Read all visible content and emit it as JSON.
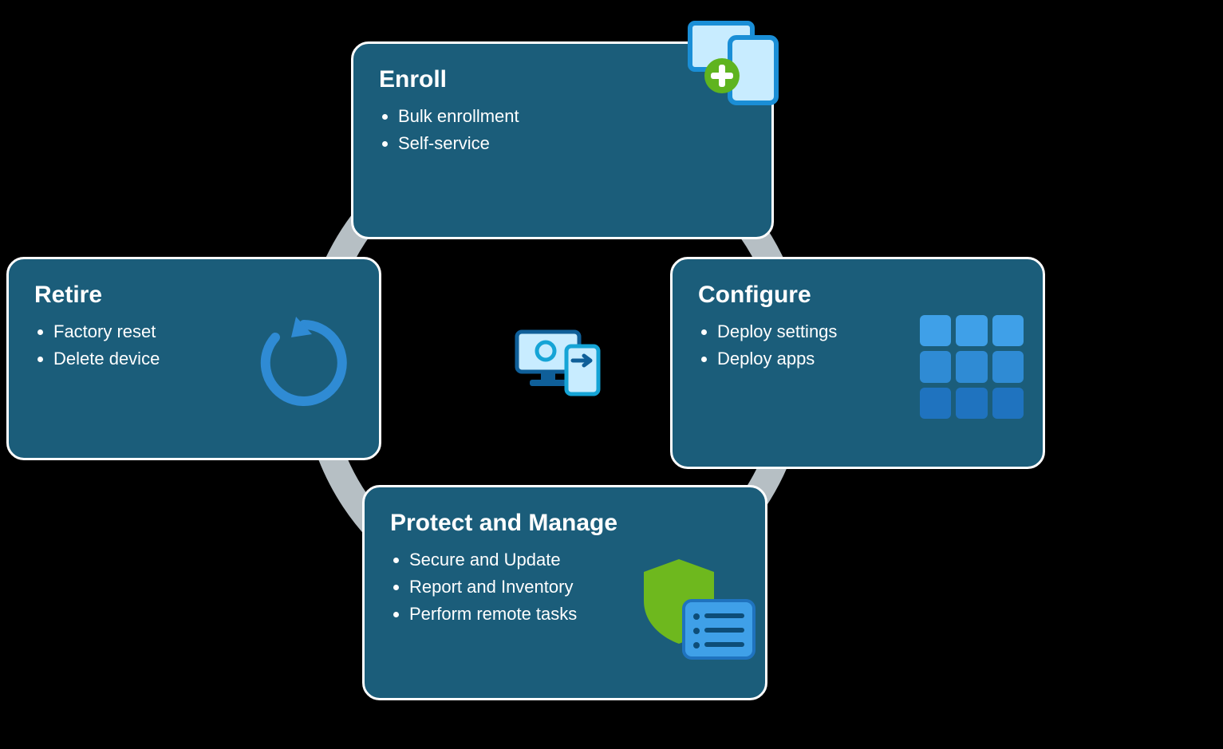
{
  "cards": {
    "enroll": {
      "title": "Enroll",
      "items": [
        "Bulk enrollment",
        "Self-service"
      ]
    },
    "configure": {
      "title": "Configure",
      "items": [
        "Deploy settings",
        "Deploy apps"
      ]
    },
    "protect": {
      "title": "Protect and Manage",
      "items": [
        "Secure and Update",
        "Report and Inventory",
        "Perform remote tasks"
      ]
    },
    "retire": {
      "title": "Retire",
      "items": [
        "Factory reset",
        "Delete device"
      ]
    }
  }
}
